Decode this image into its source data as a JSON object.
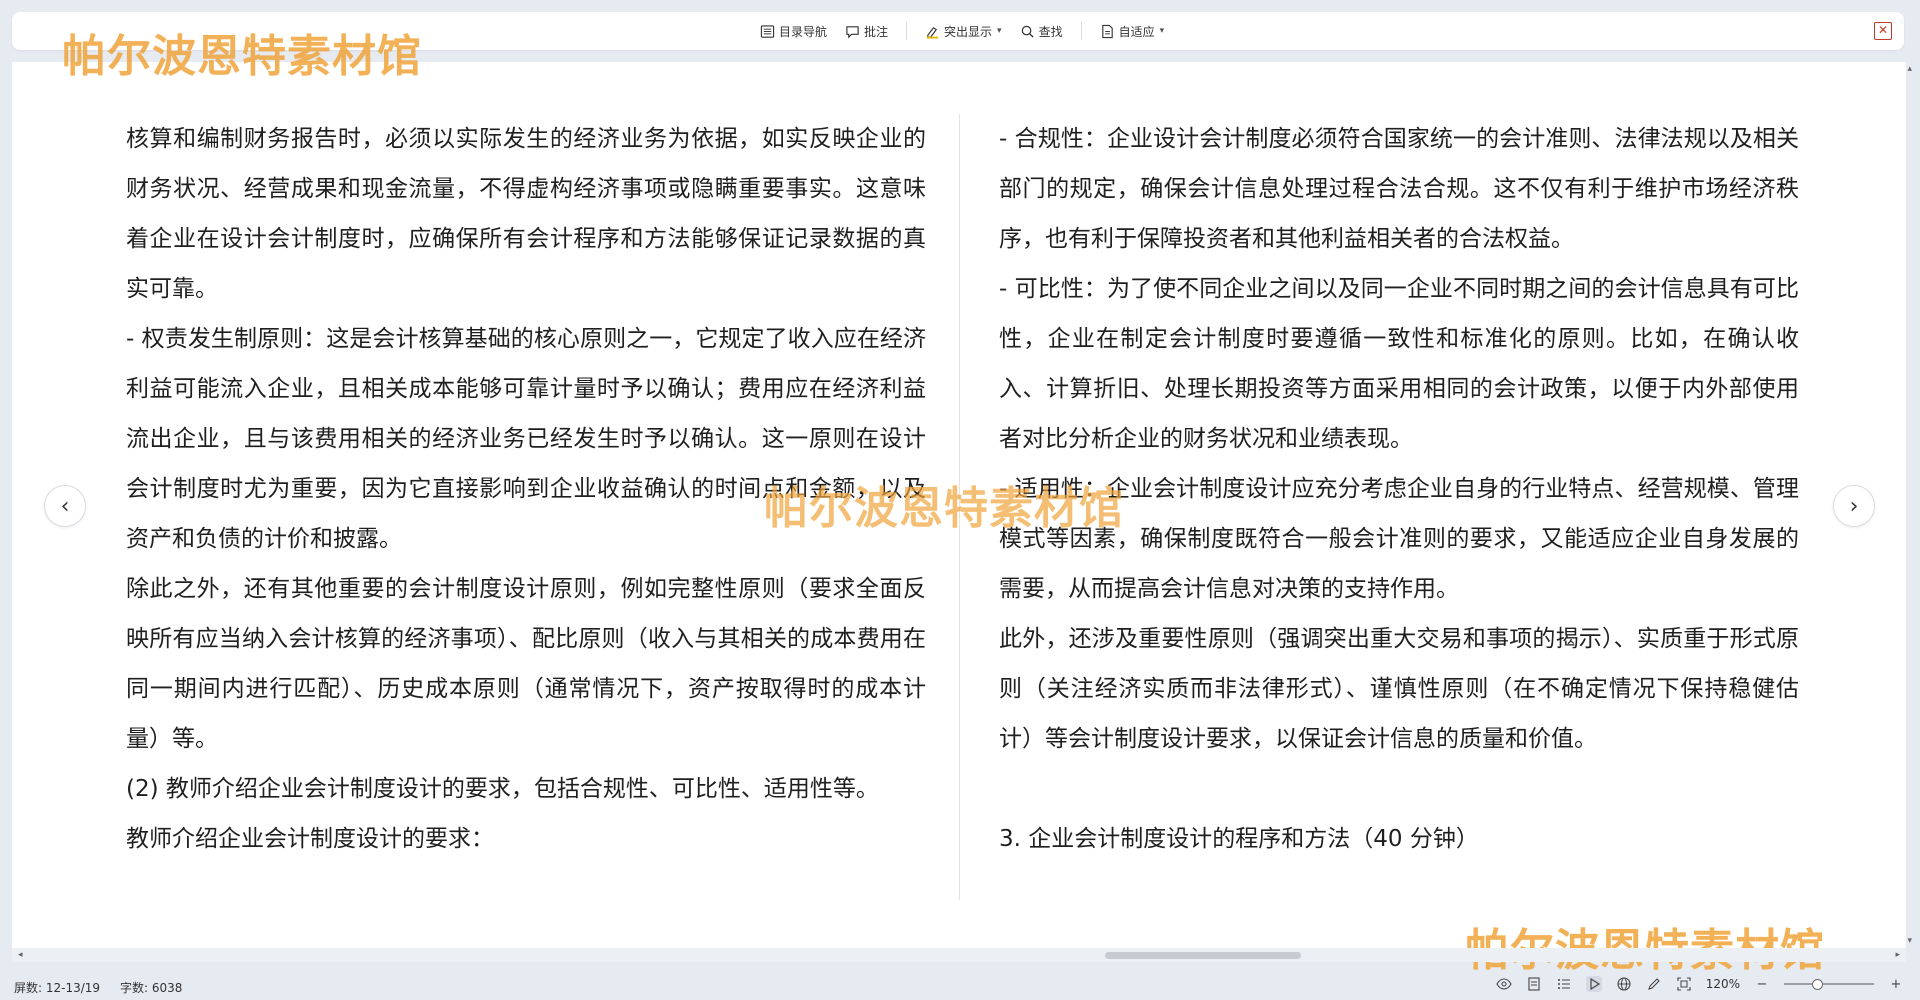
{
  "toolbar": {
    "toc_label": "目录导航",
    "comment_label": "批注",
    "highlight_label": "突出显示",
    "find_label": "查找",
    "fit_label": "自适应",
    "close_symbol": "✕",
    "icons": [
      "toc-icon",
      "comment-icon",
      "highlight-icon",
      "search-icon",
      "page-fit-icon",
      "close-icon"
    ]
  },
  "watermark": {
    "text": "帕尔波恩特素材馆"
  },
  "document": {
    "left_column": [
      "核算和编制财务报告时，必须以实际发生的经济业务为依据，如实反映企业的财务状况、经营成果和现金流量，不得虚构经济事项或隐瞒重要事实。这意味着企业在设计会计制度时，应确保所有会计程序和方法能够保证记录数据的真实可靠。",
      "- 权责发生制原则：这是会计核算基础的核心原则之一，它规定了收入应在经济利益可能流入企业，且相关成本能够可靠计量时予以确认；费用应在经济利益流出企业，且与该费用相关的经济业务已经发生时予以确认。这一原则在设计会计制度时尤为重要，因为它直接影响到企业收益确认的时间点和金额，以及资产和负债的计价和披露。",
      "除此之外，还有其他重要的会计制度设计原则，例如完整性原则（要求全面反映所有应当纳入会计核算的经济事项）、配比原则（收入与其相关的成本费用在同一期间内进行匹配）、历史成本原则（通常情况下，资产按取得时的成本计量）等。",
      "(2) 教师介绍企业会计制度设计的要求，包括合规性、可比性、适用性等。",
      "教师介绍企业会计制度设计的要求："
    ],
    "right_column": [
      "- 合规性：企业设计会计制度必须符合国家统一的会计准则、法律法规以及相关部门的规定，确保会计信息处理过程合法合规。这不仅有利于维护市场经济秩序，也有利于保障投资者和其他利益相关者的合法权益。",
      "- 可比性：为了使不同企业之间以及同一企业不同时期之间的会计信息具有可比性，企业在制定会计制度时要遵循一致性和标准化的原则。比如，在确认收入、计算折旧、处理长期投资等方面采用相同的会计政策，以便于内外部使用者对比分析企业的财务状况和业绩表现。",
      "- 适用性：企业会计制度设计应充分考虑企业自身的行业特点、经营规模、管理模式等因素，确保制度既符合一般会计准则的要求，又能适应企业自身发展的需要，从而提高会计信息对决策的支持作用。",
      "此外，还涉及重要性原则（强调突出重大交易和事项的揭示）、实质重于形式原则（关注经济实质而非法律形式）、谨慎性原则（在不确定情况下保持稳健估计）等会计制度设计要求，以保证会计信息的质量和价值。",
      "",
      "3. 企业会计制度设计的程序和方法（40 分钟）"
    ],
    "prev_symbol": "‹",
    "next_symbol": "›"
  },
  "status": {
    "page_info": "屏数: 12-13/19",
    "word_count": "字数: 6038",
    "zoom": "120%",
    "zoom_minus": "−",
    "zoom_plus": "+",
    "zoom_level_percent": 35,
    "icons": [
      "eye-icon",
      "outline-icon",
      "list-icon",
      "play-icon",
      "globe-icon",
      "pen-icon",
      "fit-screen-icon"
    ]
  }
}
